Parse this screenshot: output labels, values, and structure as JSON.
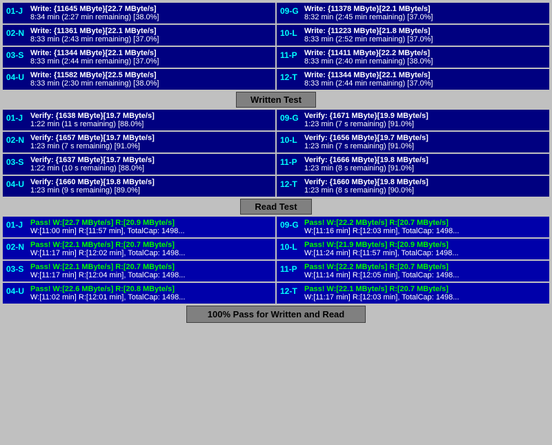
{
  "sections": {
    "write_test": {
      "label": "Written Test",
      "rows_left": [
        {
          "id": "01-J",
          "line1": "Write: {11645 MByte}[22.7 MByte/s]",
          "line2": "8:34 min (2:27 min remaining)  [38.0%]"
        },
        {
          "id": "02-N",
          "line1": "Write: {11361 MByte}[22.1 MByte/s]",
          "line2": "8:33 min (2:43 min remaining)  [37.0%]"
        },
        {
          "id": "03-S",
          "line1": "Write: {11344 MByte}[22.1 MByte/s]",
          "line2": "8:33 min (2:44 min remaining)  [37.0%]"
        },
        {
          "id": "04-U",
          "line1": "Write: {11582 MByte}[22.5 MByte/s]",
          "line2": "8:33 min (2:30 min remaining)  [38.0%]"
        }
      ],
      "rows_right": [
        {
          "id": "09-G",
          "line1": "Write: {11378 MByte}[22.1 MByte/s]",
          "line2": "8:32 min (2:45 min remaining)  [37.0%]"
        },
        {
          "id": "10-L",
          "line1": "Write: {11223 MByte}[21.8 MByte/s]",
          "line2": "8:33 min (2:52 min remaining)  [37.0%]"
        },
        {
          "id": "11-P",
          "line1": "Write: {11411 MByte}[22.2 MByte/s]",
          "line2": "8:33 min (2:40 min remaining)  [38.0%]"
        },
        {
          "id": "12-T",
          "line1": "Write: {11344 MByte}[22.1 MByte/s]",
          "line2": "8:33 min (2:44 min remaining)  [37.0%]"
        }
      ]
    },
    "verify_test": {
      "label": "Written Test",
      "rows_left": [
        {
          "id": "01-J",
          "line1": "Verify: {1638 MByte}[19.7 MByte/s]",
          "line2": "1:22 min (11 s remaining)   [88.0%]"
        },
        {
          "id": "02-N",
          "line1": "Verify: {1657 MByte}[19.7 MByte/s]",
          "line2": "1:23 min (7 s remaining)   [91.0%]"
        },
        {
          "id": "03-S",
          "line1": "Verify: {1637 MByte}[19.7 MByte/s]",
          "line2": "1:22 min (10 s remaining)   [88.0%]"
        },
        {
          "id": "04-U",
          "line1": "Verify: {1660 MByte}[19.8 MByte/s]",
          "line2": "1:23 min (9 s remaining)   [89.0%]"
        }
      ],
      "rows_right": [
        {
          "id": "09-G",
          "line1": "Verify: {1671 MByte}[19.9 MByte/s]",
          "line2": "1:23 min (7 s remaining)   [91.0%]"
        },
        {
          "id": "10-L",
          "line1": "Verify: {1656 MByte}[19.7 MByte/s]",
          "line2": "1:23 min (7 s remaining)   [91.0%]"
        },
        {
          "id": "11-P",
          "line1": "Verify: {1666 MByte}[19.8 MByte/s]",
          "line2": "1:23 min (8 s remaining)   [91.0%]"
        },
        {
          "id": "12-T",
          "line1": "Verify: {1660 MByte}[19.8 MByte/s]",
          "line2": "1:23 min (8 s remaining)   [90.0%]"
        }
      ]
    },
    "read_test": {
      "label": "Read Test",
      "rows_left": [
        {
          "id": "01-J",
          "line1": "Pass! W:[22.7 MByte/s] R:[20.9 MByte/s]",
          "line2": "W:[11:00 min] R:[11:57 min], TotalCap: 1498..."
        },
        {
          "id": "02-N",
          "line1": "Pass! W:[22.1 MByte/s] R:[20.7 MByte/s]",
          "line2": "W:[11:17 min] R:[12:02 min], TotalCap: 1498..."
        },
        {
          "id": "03-S",
          "line1": "Pass! W:[22.1 MByte/s] R:[20.7 MByte/s]",
          "line2": "W:[11:17 min] R:[12:04 min], TotalCap: 1498..."
        },
        {
          "id": "04-U",
          "line1": "Pass! W:[22.6 MByte/s] R:[20.8 MByte/s]",
          "line2": "W:[11:02 min] R:[12:01 min], TotalCap: 1498..."
        }
      ],
      "rows_right": [
        {
          "id": "09-G",
          "line1": "Pass! W:[22.2 MByte/s] R:[20.7 MByte/s]",
          "line2": "W:[11:16 min] R:[12:03 min], TotalCap: 1498..."
        },
        {
          "id": "10-L",
          "line1": "Pass! W:[21.9 MByte/s] R:[20.9 MByte/s]",
          "line2": "W:[11:24 min] R:[11:57 min], TotalCap: 1498..."
        },
        {
          "id": "11-P",
          "line1": "Pass! W:[22.2 MByte/s] R:[20.7 MByte/s]",
          "line2": "W:[11:14 min] R:[12:05 min], TotalCap: 1498..."
        },
        {
          "id": "12-T",
          "line1": "Pass! W:[22.1 MByte/s] R:[20.7 MByte/s]",
          "line2": "W:[11:17 min] R:[12:03 min], TotalCap: 1498..."
        }
      ]
    }
  },
  "footer": "100% Pass for Written and Read"
}
